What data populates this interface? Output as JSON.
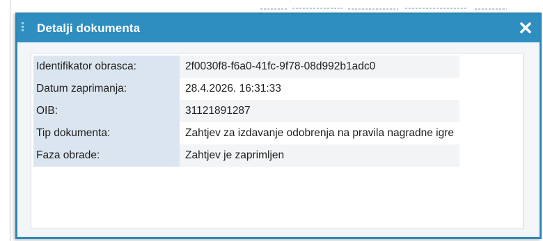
{
  "dialog": {
    "title": "Detalji dokumenta",
    "close_icon": "close-icon",
    "rows": [
      {
        "label": "Identifikator obrasca:",
        "value": "2f0030f8-f6a0-41fc-9f78-08d992b1adc0"
      },
      {
        "label": "Datum zaprimanja:",
        "value": "28.4.2026. 16:31:33"
      },
      {
        "label": "OIB:",
        "value": "31121891287"
      },
      {
        "label": "Tip dokumenta:",
        "value": "Zahtjev za izdavanje odobrenja na pravila nagradne igre"
      },
      {
        "label": "Faza obrade:",
        "value": "Zahtjev je zaprimljen"
      }
    ]
  },
  "colors": {
    "titlebar": "#2f8ec0",
    "border": "#2d87b6",
    "label_bg": "#dbe5f0"
  }
}
